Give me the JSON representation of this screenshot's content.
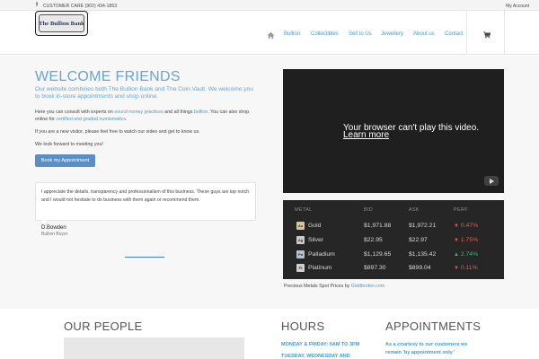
{
  "topbar": {
    "facebook_icon": "facebook-icon",
    "customer_care": "CUSTOMER CARE (902) 434-1853",
    "my_account": "My Account"
  },
  "header": {
    "logo_text": "The Bullion Bank",
    "nav": [
      "Bullion",
      "Collectibles",
      "Sell to Us",
      "Jewellery",
      "About us",
      "Contact"
    ],
    "home_icon": "home-icon",
    "cart_icon": "cart-icon"
  },
  "welcome": {
    "title": "WELCOME FRIENDS",
    "intro": "Our website combines both The Bullion Bank and The Coin Vault. We welcome you to book in-store appointments and shop online.",
    "p1_a": "Here you can consult with experts on ",
    "p1_link1": "sound money practices",
    "p1_b": " and all things ",
    "p1_link2": "bullion",
    "p1_c": ". You can also shop online for ",
    "p1_link3": "certified and graded numismatics",
    "p1_d": ".",
    "p2": "If you are a new visitor, please feel free to watch our video and get to know us.",
    "p3": "We look forward to meeting you!",
    "button": "Book my Appointment"
  },
  "testimonial": {
    "quote": "I appreciate the details, transparency and professionalism of this business. These guys are top notch and I would not hesitate to do business with them again or recommend them.",
    "author": "D.Bowden",
    "role": "Bullion Buyer"
  },
  "video": {
    "message": "Your browser can't play this video.",
    "link": "Learn more",
    "youtube_icon": "youtube-icon"
  },
  "metals": {
    "headers": [
      "METAL",
      "BID",
      "ASK",
      "PERF"
    ],
    "rows": [
      {
        "symbol": "Au",
        "name": "Gold",
        "bid": "$1,971.88",
        "ask": "$1,972.21",
        "perf": "0.47%",
        "dir": "down",
        "color": "#e15a5a"
      },
      {
        "symbol": "Ag",
        "name": "Silver",
        "bid": "$22.95",
        "ask": "$22.97",
        "perf": "1.75%",
        "dir": "down",
        "color": "#e15a5a"
      },
      {
        "symbol": "Pd",
        "name": "Palladium",
        "bid": "$1,129.65",
        "ask": "$1,135.42",
        "perf": "2.74%",
        "dir": "up",
        "color": "#43b581"
      },
      {
        "symbol": "Pt",
        "name": "Platinum",
        "bid": "$897.30",
        "ask": "$899.04",
        "perf": "0.11%",
        "dir": "down",
        "color": "#e15a5a"
      }
    ],
    "credit_a": "Precious Metals Spot Prices by ",
    "credit_link": "Goldbroker.com"
  },
  "bottom": {
    "people_title": "OUR PEOPLE",
    "hours_title": "HOURS",
    "hours_line1": "MONDAY & FRIDAY: 9AM TO 3PM",
    "hours_line2": "TUESDAY, WEDNESDAY AND",
    "appt_title": "APPOINTMENTS",
    "appt_line1": "As a courtesy to our customers we",
    "appt_line2": "remain 'by appointment only.'"
  },
  "colors": {
    "accent": "#3d9dd3",
    "title_blue": "#6aa4cf",
    "button": "#5b8ec4",
    "down": "#e15a5a",
    "up": "#43b581"
  }
}
